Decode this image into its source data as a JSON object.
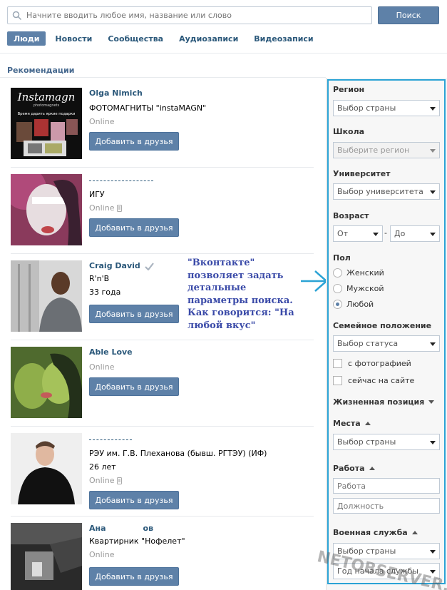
{
  "search": {
    "placeholder": "Начните вводить любое имя, название или слово",
    "button": "Поиск"
  },
  "tabs": [
    {
      "label": "Люди",
      "active": true
    },
    {
      "label": "Новости"
    },
    {
      "label": "Сообщества"
    },
    {
      "label": "Аудиозаписи"
    },
    {
      "label": "Видеозаписи"
    }
  ],
  "section_title": "Рекомендации",
  "add_button": "Добавить в друзья",
  "people": [
    {
      "name": "Olga Nimich",
      "line1": "ФОТОМАГНИТЫ \"instaMAGN\"",
      "line2": "",
      "status": "Online",
      "photo_text": "Instamagn",
      "photo_subtext": "photomagnets",
      "photo_caption": "Время дарить яркие подарки"
    },
    {
      "name": "",
      "line1": "ИГУ",
      "line2": "",
      "status": "Online"
    },
    {
      "name": "Craig David",
      "line1": "R'n'B",
      "line2": "33 года",
      "status": ""
    },
    {
      "name": "Able Love",
      "line1": "",
      "line2": "",
      "status": "Online"
    },
    {
      "name": "",
      "line1": "РЭУ им. Г.В. Плеханова (бывш. РГТЭУ) (ИФ)",
      "line2": "26 лет",
      "status": "Online"
    },
    {
      "name": "Ана",
      "name_tail": "ов",
      "line1": "Квартирник \"Нофелет\"",
      "line2": "",
      "status": "Online"
    }
  ],
  "annotation": "\"Вконтакте\" позволяет задать детальные параметры поиска. Как говорится: \"На любой вкус\"",
  "filters": {
    "region_label": "Регион",
    "region_value": "Выбор страны",
    "school_label": "Школа",
    "school_value": "Выберите регион",
    "university_label": "Университет",
    "university_value": "Выбор университета",
    "age_label": "Возраст",
    "age_from": "От",
    "age_dash": "-",
    "age_to": "До",
    "sex_label": "Пол",
    "sex_options": [
      "Женский",
      "Мужской",
      "Любой"
    ],
    "sex_selected": "Любой",
    "family_label": "Семейное положение",
    "family_value": "Выбор статуса",
    "with_photo": "с фотографией",
    "online_now": "сейчас на сайте",
    "life_label": "Жизненная позиция",
    "places_label": "Места",
    "places_value": "Выбор страны",
    "work_label": "Работа",
    "work_placeholder": "Работа",
    "position_placeholder": "Должность",
    "military_label": "Военная служба",
    "military_country": "Выбор страны",
    "military_year": "Год начала службы"
  },
  "watermark": "NETOBSERVER.RU",
  "colors": {
    "accent": "#5e81a8",
    "link": "#2b587a",
    "frame": "#2ba3d5",
    "annotation": "#3a4aa8"
  }
}
